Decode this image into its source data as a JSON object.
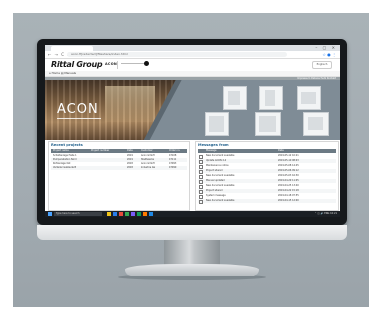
{
  "browser": {
    "tab_title": "x",
    "nav_icons": "← → C ⌂",
    "address": "acon.fl[redacted]/fileshare/index.html",
    "window_controls": "– ▢ ✕",
    "extension_icons": "☆ ● ⋮"
  },
  "site": {
    "logo": "Rittal Group",
    "logo_sub": "",
    "brand": "ACON",
    "header_button": "Englisch",
    "toolbar_left": "⌂ Home   ▤ Manuals",
    "toolbar_right": "Impressum   Datenschutz   Kontakt"
  },
  "hero": {
    "title": "ACON",
    "tiles": [
      {
        "label": ""
      },
      {
        "label": ""
      },
      {
        "label": ""
      },
      {
        "label": ""
      },
      {
        "label": ""
      },
      {
        "label": ""
      }
    ]
  },
  "left_panel": {
    "title": "Recent projects",
    "columns": [
      "Project name",
      "Project number",
      "Date",
      "Customer",
      "Order no."
    ],
    "rows": [
      [
        "Schaltanlage Halle 1",
        "",
        "2019",
        "Acon GmbH",
        "47108"
      ],
      [
        "Pumpenstation Nord",
        "",
        "2019",
        "Stadtwerke",
        "47111"
      ],
      [
        "Kühlanlage Ost",
        "",
        "2018",
        "Acon GmbH",
        "47093"
      ],
      [
        "Verteiler Gebäude B",
        "",
        "2018",
        "Industrie AG",
        "47090"
      ]
    ]
  },
  "right_panel": {
    "title": "Messages from",
    "columns": [
      "Message",
      "Date"
    ],
    "rows": [
      [
        "New document available",
        "2019-05-12 10:21"
      ],
      [
        "Update ACON 2.4",
        "2019-05-10 08:03"
      ],
      [
        "Maintenance notice",
        "2019-05-08 14:45"
      ],
      [
        "Project shared",
        "2019-05-06 09:12"
      ],
      [
        "New document available",
        "2019-05-03 16:30"
      ],
      [
        "Manual updated",
        "2019-04-29 11:05"
      ],
      [
        "New document available",
        "2019-04-25 13:40"
      ],
      [
        "Project shared",
        "2019-04-22 15:18"
      ],
      [
        "System message",
        "2019-04-18 07:55"
      ],
      [
        "New document available",
        "2019-04-15 12:00"
      ]
    ]
  },
  "taskbar": {
    "search_placeholder": "Type here to search",
    "tray": "⌃ ◫ 🔊 ENG 10:21"
  },
  "colors": {
    "background": "#a2abb1",
    "bezel": "#16191c",
    "hero_slate": "#7f8c96",
    "header_link": "#1f5f8b",
    "taskbar": "#1b1f24"
  }
}
